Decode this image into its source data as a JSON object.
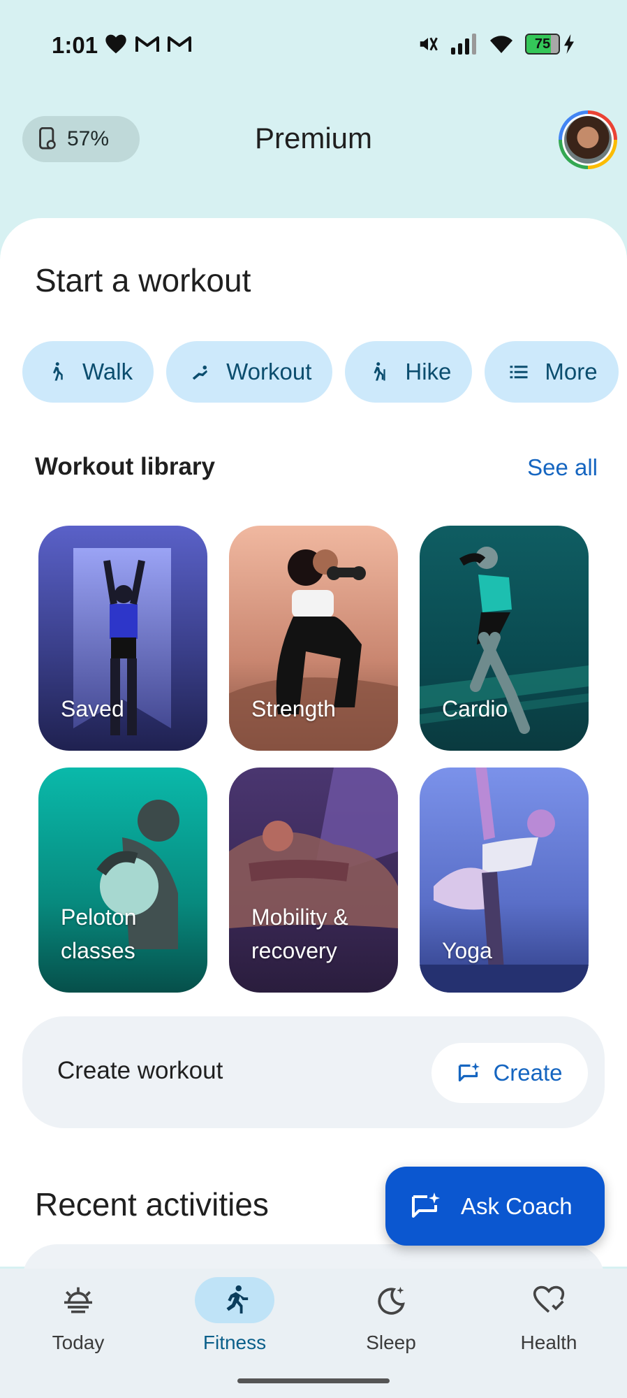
{
  "status_bar": {
    "time": "1:01",
    "battery_level": "75",
    "left_icons": [
      "heart-icon",
      "gmail-icon",
      "gmail-icon"
    ],
    "right_icons": [
      "mute-icon",
      "signal-icon",
      "wifi-icon",
      "battery-icon",
      "charging-icon"
    ]
  },
  "header": {
    "device_battery": "57%",
    "title": "Premium"
  },
  "start_workout": {
    "title": "Start a workout",
    "chips": [
      {
        "label": "Walk",
        "icon": "walk-icon"
      },
      {
        "label": "Workout",
        "icon": "workout-icon"
      },
      {
        "label": "Hike",
        "icon": "hike-icon"
      },
      {
        "label": "More",
        "icon": "list-icon"
      }
    ]
  },
  "library": {
    "title": "Workout library",
    "see_all": "See all",
    "tiles": [
      {
        "label": "Saved",
        "color": "#5b63c9"
      },
      {
        "label": "Strength",
        "color": "#e8a38a"
      },
      {
        "label": "Cardio",
        "color": "#0f5b5f"
      },
      {
        "label_line1": "Peloton",
        "label_line2": "classes",
        "color": "#08a89a"
      },
      {
        "label_line1": "Mobility &",
        "label_line2": "recovery",
        "color": "#3c2a55"
      },
      {
        "label": "Yoga",
        "color": "#6f86dd"
      }
    ]
  },
  "create_workout": {
    "text": "Create workout",
    "button_label": "Create"
  },
  "recent": {
    "title": "Recent activities"
  },
  "ask_coach": {
    "label": "Ask Coach"
  },
  "bottom_nav": {
    "items": [
      {
        "label": "Today",
        "icon": "sunrise-icon"
      },
      {
        "label": "Fitness",
        "icon": "run-icon",
        "active": true
      },
      {
        "label": "Sleep",
        "icon": "moon-icon"
      },
      {
        "label": "Health",
        "icon": "heart-check-icon"
      }
    ]
  },
  "colors": {
    "background": "#d7f1f2",
    "accent": "#0b57d0",
    "chip": "#cde9fb",
    "link": "#1565c0"
  }
}
